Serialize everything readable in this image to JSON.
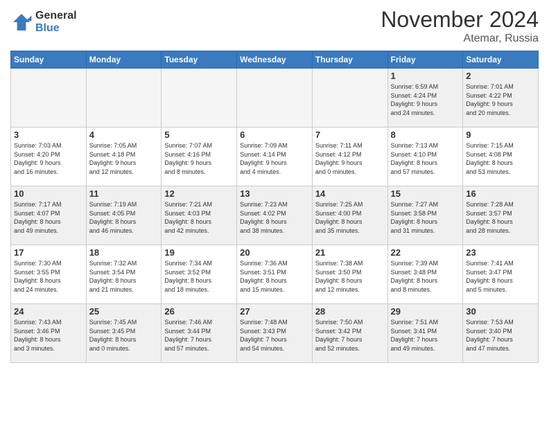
{
  "logo": {
    "line1": "General",
    "line2": "Blue"
  },
  "header": {
    "month": "November 2024",
    "location": "Atemar, Russia"
  },
  "weekdays": [
    "Sunday",
    "Monday",
    "Tuesday",
    "Wednesday",
    "Thursday",
    "Friday",
    "Saturday"
  ],
  "weeks": [
    [
      {
        "day": "",
        "info": "",
        "empty": true
      },
      {
        "day": "",
        "info": "",
        "empty": true
      },
      {
        "day": "",
        "info": "",
        "empty": true
      },
      {
        "day": "",
        "info": "",
        "empty": true
      },
      {
        "day": "",
        "info": "",
        "empty": true
      },
      {
        "day": "1",
        "info": "Sunrise: 6:59 AM\nSunset: 4:24 PM\nDaylight: 9 hours\nand 24 minutes.",
        "empty": false
      },
      {
        "day": "2",
        "info": "Sunrise: 7:01 AM\nSunset: 4:22 PM\nDaylight: 9 hours\nand 20 minutes.",
        "empty": false
      }
    ],
    [
      {
        "day": "3",
        "info": "Sunrise: 7:03 AM\nSunset: 4:20 PM\nDaylight: 9 hours\nand 16 minutes.",
        "empty": false
      },
      {
        "day": "4",
        "info": "Sunrise: 7:05 AM\nSunset: 4:18 PM\nDaylight: 9 hours\nand 12 minutes.",
        "empty": false
      },
      {
        "day": "5",
        "info": "Sunrise: 7:07 AM\nSunset: 4:16 PM\nDaylight: 9 hours\nand 8 minutes.",
        "empty": false
      },
      {
        "day": "6",
        "info": "Sunrise: 7:09 AM\nSunset: 4:14 PM\nDaylight: 9 hours\nand 4 minutes.",
        "empty": false
      },
      {
        "day": "7",
        "info": "Sunrise: 7:11 AM\nSunset: 4:12 PM\nDaylight: 9 hours\nand 0 minutes.",
        "empty": false
      },
      {
        "day": "8",
        "info": "Sunrise: 7:13 AM\nSunset: 4:10 PM\nDaylight: 8 hours\nand 57 minutes.",
        "empty": false
      },
      {
        "day": "9",
        "info": "Sunrise: 7:15 AM\nSunset: 4:08 PM\nDaylight: 8 hours\nand 53 minutes.",
        "empty": false
      }
    ],
    [
      {
        "day": "10",
        "info": "Sunrise: 7:17 AM\nSunset: 4:07 PM\nDaylight: 8 hours\nand 49 minutes.",
        "empty": false
      },
      {
        "day": "11",
        "info": "Sunrise: 7:19 AM\nSunset: 4:05 PM\nDaylight: 8 hours\nand 46 minutes.",
        "empty": false
      },
      {
        "day": "12",
        "info": "Sunrise: 7:21 AM\nSunset: 4:03 PM\nDaylight: 8 hours\nand 42 minutes.",
        "empty": false
      },
      {
        "day": "13",
        "info": "Sunrise: 7:23 AM\nSunset: 4:02 PM\nDaylight: 8 hours\nand 38 minutes.",
        "empty": false
      },
      {
        "day": "14",
        "info": "Sunrise: 7:25 AM\nSunset: 4:00 PM\nDaylight: 8 hours\nand 35 minutes.",
        "empty": false
      },
      {
        "day": "15",
        "info": "Sunrise: 7:27 AM\nSunset: 3:58 PM\nDaylight: 8 hours\nand 31 minutes.",
        "empty": false
      },
      {
        "day": "16",
        "info": "Sunrise: 7:28 AM\nSunset: 3:57 PM\nDaylight: 8 hours\nand 28 minutes.",
        "empty": false
      }
    ],
    [
      {
        "day": "17",
        "info": "Sunrise: 7:30 AM\nSunset: 3:55 PM\nDaylight: 8 hours\nand 24 minutes.",
        "empty": false
      },
      {
        "day": "18",
        "info": "Sunrise: 7:32 AM\nSunset: 3:54 PM\nDaylight: 8 hours\nand 21 minutes.",
        "empty": false
      },
      {
        "day": "19",
        "info": "Sunrise: 7:34 AM\nSunset: 3:52 PM\nDaylight: 8 hours\nand 18 minutes.",
        "empty": false
      },
      {
        "day": "20",
        "info": "Sunrise: 7:36 AM\nSunset: 3:51 PM\nDaylight: 8 hours\nand 15 minutes.",
        "empty": false
      },
      {
        "day": "21",
        "info": "Sunrise: 7:38 AM\nSunset: 3:50 PM\nDaylight: 8 hours\nand 12 minutes.",
        "empty": false
      },
      {
        "day": "22",
        "info": "Sunrise: 7:39 AM\nSunset: 3:48 PM\nDaylight: 8 hours\nand 8 minutes.",
        "empty": false
      },
      {
        "day": "23",
        "info": "Sunrise: 7:41 AM\nSunset: 3:47 PM\nDaylight: 8 hours\nand 5 minutes.",
        "empty": false
      }
    ],
    [
      {
        "day": "24",
        "info": "Sunrise: 7:43 AM\nSunset: 3:46 PM\nDaylight: 8 hours\nand 3 minutes.",
        "empty": false
      },
      {
        "day": "25",
        "info": "Sunrise: 7:45 AM\nSunset: 3:45 PM\nDaylight: 8 hours\nand 0 minutes.",
        "empty": false
      },
      {
        "day": "26",
        "info": "Sunrise: 7:46 AM\nSunset: 3:44 PM\nDaylight: 7 hours\nand 57 minutes.",
        "empty": false
      },
      {
        "day": "27",
        "info": "Sunrise: 7:48 AM\nSunset: 3:43 PM\nDaylight: 7 hours\nand 54 minutes.",
        "empty": false
      },
      {
        "day": "28",
        "info": "Sunrise: 7:50 AM\nSunset: 3:42 PM\nDaylight: 7 hours\nand 52 minutes.",
        "empty": false
      },
      {
        "day": "29",
        "info": "Sunrise: 7:51 AM\nSunset: 3:41 PM\nDaylight: 7 hours\nand 49 minutes.",
        "empty": false
      },
      {
        "day": "30",
        "info": "Sunrise: 7:53 AM\nSunset: 3:40 PM\nDaylight: 7 hours\nand 47 minutes.",
        "empty": false
      }
    ]
  ]
}
